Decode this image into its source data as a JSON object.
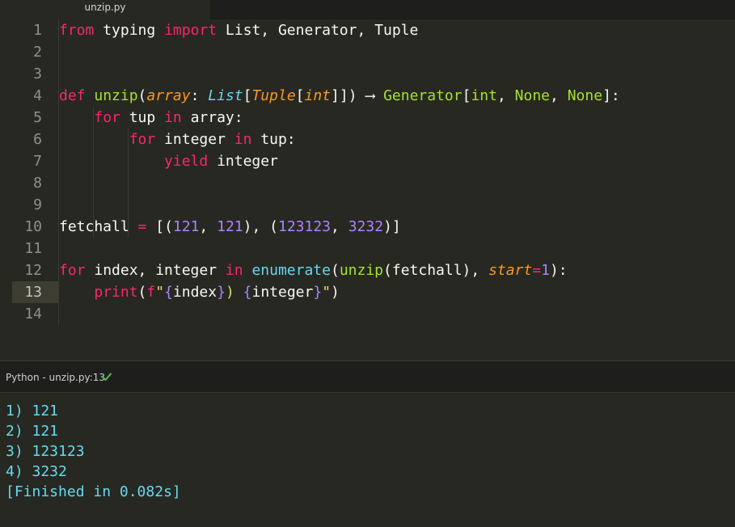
{
  "tab": {
    "filename": "unzip.py"
  },
  "editor": {
    "current_line": 13,
    "lines": [
      {
        "n": "1",
        "tokens": [
          [
            "kw",
            "from"
          ],
          [
            "plain",
            " typing "
          ],
          [
            "kw",
            "import"
          ],
          [
            "plain",
            " List, Generator, Tuple"
          ]
        ]
      },
      {
        "n": "2",
        "tokens": []
      },
      {
        "n": "3",
        "tokens": []
      },
      {
        "n": "4",
        "tokens": [
          [
            "kw",
            "def"
          ],
          [
            "plain",
            " "
          ],
          [
            "fn",
            "unzip"
          ],
          [
            "plain",
            "("
          ],
          [
            "param",
            "array"
          ],
          [
            "plain",
            ": "
          ],
          [
            "typei",
            "List"
          ],
          [
            "plain",
            "["
          ],
          [
            "typeo",
            "Tuple"
          ],
          [
            "plain",
            "["
          ],
          [
            "typeo",
            "int"
          ],
          [
            "plain",
            "]]) "
          ],
          [
            "plain",
            "⟶"
          ],
          [
            "plain",
            " "
          ],
          [
            "cls",
            "Generator"
          ],
          [
            "plain",
            "["
          ],
          [
            "cls",
            "int"
          ],
          [
            "plain",
            ", "
          ],
          [
            "cls",
            "None"
          ],
          [
            "plain",
            ", "
          ],
          [
            "cls",
            "None"
          ],
          [
            "plain",
            "]:"
          ]
        ]
      },
      {
        "n": "5",
        "tokens": [
          [
            "plain",
            "    "
          ],
          [
            "kw",
            "for"
          ],
          [
            "plain",
            " tup "
          ],
          [
            "kw",
            "in"
          ],
          [
            "plain",
            " array:"
          ]
        ]
      },
      {
        "n": "6",
        "tokens": [
          [
            "plain",
            "        "
          ],
          [
            "kw",
            "for"
          ],
          [
            "plain",
            " integer "
          ],
          [
            "kw",
            "in"
          ],
          [
            "plain",
            " tup:"
          ]
        ]
      },
      {
        "n": "7",
        "tokens": [
          [
            "plain",
            "            "
          ],
          [
            "kw",
            "yield"
          ],
          [
            "plain",
            " integer"
          ]
        ]
      },
      {
        "n": "8",
        "tokens": []
      },
      {
        "n": "9",
        "tokens": []
      },
      {
        "n": "10",
        "tokens": [
          [
            "plain",
            "fetchall "
          ],
          [
            "kw",
            "="
          ],
          [
            "plain",
            " [("
          ],
          [
            "num",
            "121"
          ],
          [
            "plain",
            ", "
          ],
          [
            "num",
            "121"
          ],
          [
            "plain",
            "), ("
          ],
          [
            "num",
            "123123"
          ],
          [
            "plain",
            ", "
          ],
          [
            "num",
            "3232"
          ],
          [
            "plain",
            ")]"
          ]
        ]
      },
      {
        "n": "11",
        "tokens": []
      },
      {
        "n": "12",
        "tokens": [
          [
            "kw",
            "for"
          ],
          [
            "plain",
            " index, integer "
          ],
          [
            "kw",
            "in"
          ],
          [
            "plain",
            " "
          ],
          [
            "bi",
            "enumerate"
          ],
          [
            "plain",
            "("
          ],
          [
            "fn",
            "unzip"
          ],
          [
            "plain",
            "(fetchall), "
          ],
          [
            "param",
            "start"
          ],
          [
            "kw",
            "="
          ],
          [
            "num",
            "1"
          ],
          [
            "plain",
            "):"
          ]
        ]
      },
      {
        "n": "13",
        "tokens": [
          [
            "plain",
            "    "
          ],
          [
            "kw",
            "print"
          ],
          [
            "plain",
            "("
          ],
          [
            "kw",
            "f"
          ],
          [
            "str",
            "\""
          ],
          [
            "brace",
            "{"
          ],
          [
            "plain",
            "index"
          ],
          [
            "brace",
            "}"
          ],
          [
            "str",
            ") "
          ],
          [
            "brace",
            "{"
          ],
          [
            "plain",
            "integer"
          ],
          [
            "brace",
            "}"
          ],
          [
            "str",
            "\""
          ],
          [
            "plain",
            ")"
          ]
        ]
      },
      {
        "n": "14",
        "tokens": []
      }
    ]
  },
  "status": {
    "text": "Python - unzip.py:13",
    "check_icon": "check-icon",
    "check_color": "#5fb760"
  },
  "output": {
    "lines": [
      "1) 121",
      "2) 121",
      "3) 123123",
      "4) 3232",
      "[Finished in 0.082s]"
    ]
  }
}
